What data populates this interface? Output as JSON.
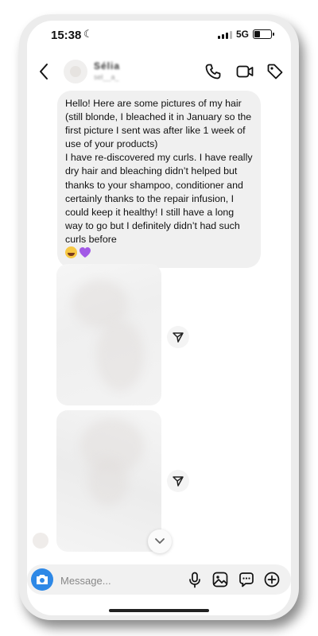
{
  "status_bar": {
    "time": "15:38",
    "network": "5G",
    "battery_level": 0.35
  },
  "header": {
    "name": "Sélia",
    "subtitle": "sel__a_"
  },
  "message": {
    "paragraphs": [
      "Hello! Here are some pictures of my hair (still blonde, I bleached it in January so the first picture I sent was after like 1 week of use of your products)",
      "I have re-discovered my curls. I have really dry hair and bleaching didn’t helped but thanks to your shampoo, conditioner and certainly thanks to the repair infusion, I could keep it healthy! I still have a long way to go but I definitely didn’t had such curls before"
    ]
  },
  "composer": {
    "placeholder": "Message..."
  },
  "colors": {
    "accent": "#2d88e6",
    "bubble": "#f0f0f0",
    "heart": "#a259e6"
  },
  "icons": {
    "back": "chevron-left-icon",
    "call": "phone-icon",
    "video": "video-camera-icon",
    "tag": "tag-icon",
    "share": "send-icon",
    "camera": "camera-icon",
    "mic": "microphone-icon",
    "gallery": "image-icon",
    "sticker": "sticker-icon",
    "add": "plus-circle-icon"
  }
}
